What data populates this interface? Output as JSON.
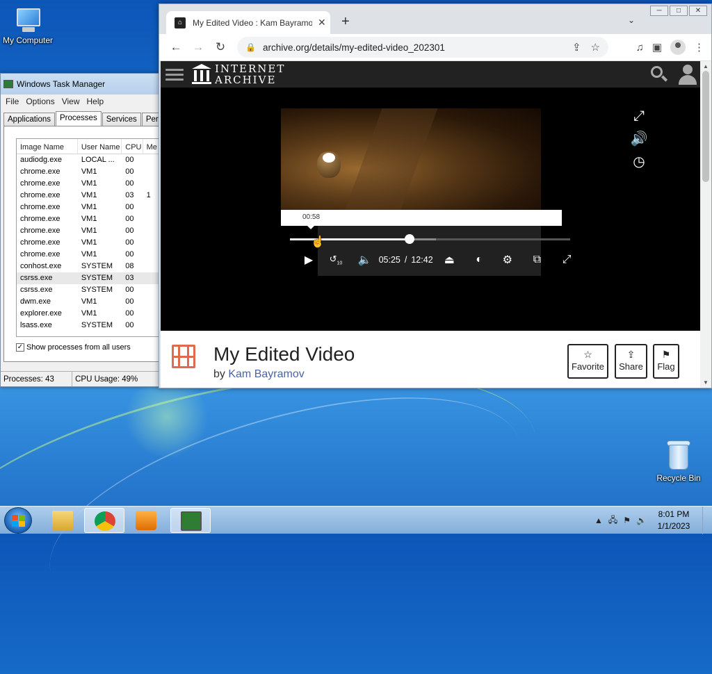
{
  "desktop": {
    "my_computer": "My Computer",
    "recycle_bin": "Recycle Bin"
  },
  "task_manager": {
    "title": "Windows Task Manager",
    "menu": [
      "File",
      "Options",
      "View",
      "Help"
    ],
    "tabs": [
      "Applications",
      "Processes",
      "Services",
      "Perform"
    ],
    "active_tab": "Processes",
    "columns": [
      "Image Name",
      "User Name",
      "CPU",
      "Me"
    ],
    "rows": [
      {
        "name": "audiodg.exe",
        "user": "LOCAL ...",
        "cpu": "00",
        "mem": ""
      },
      {
        "name": "chrome.exe",
        "user": "VM1",
        "cpu": "00",
        "mem": ""
      },
      {
        "name": "chrome.exe",
        "user": "VM1",
        "cpu": "00",
        "mem": ""
      },
      {
        "name": "chrome.exe",
        "user": "VM1",
        "cpu": "03",
        "mem": "1"
      },
      {
        "name": "chrome.exe",
        "user": "VM1",
        "cpu": "00",
        "mem": ""
      },
      {
        "name": "chrome.exe",
        "user": "VM1",
        "cpu": "00",
        "mem": ""
      },
      {
        "name": "chrome.exe",
        "user": "VM1",
        "cpu": "00",
        "mem": ""
      },
      {
        "name": "chrome.exe",
        "user": "VM1",
        "cpu": "00",
        "mem": ""
      },
      {
        "name": "chrome.exe",
        "user": "VM1",
        "cpu": "00",
        "mem": ""
      },
      {
        "name": "conhost.exe",
        "user": "SYSTEM",
        "cpu": "08",
        "mem": ""
      },
      {
        "name": "csrss.exe",
        "user": "SYSTEM",
        "cpu": "03",
        "mem": ""
      },
      {
        "name": "csrss.exe",
        "user": "SYSTEM",
        "cpu": "00",
        "mem": ""
      },
      {
        "name": "dwm.exe",
        "user": "VM1",
        "cpu": "00",
        "mem": ""
      },
      {
        "name": "explorer.exe",
        "user": "VM1",
        "cpu": "00",
        "mem": ""
      },
      {
        "name": "lsass.exe",
        "user": "SYSTEM",
        "cpu": "00",
        "mem": ""
      }
    ],
    "show_all_label": "Show processes from all users",
    "status_processes": "Processes: 43",
    "status_cpu": "CPU Usage: 49%"
  },
  "browser": {
    "tab_title": "My Edited Video : Kam Bayramov",
    "url": "archive.org/details/my-edited-video_202301",
    "window_controls": [
      "─",
      "□",
      "✕"
    ]
  },
  "archive": {
    "logo_line1": "INTERNET",
    "logo_line2": "ARCHIVE",
    "player": {
      "preview_time": "00:58",
      "current_time": "05:25",
      "separator": "/",
      "duration": "12:42",
      "progress_fraction": 0.426,
      "buffered_fraction": 0.52,
      "skip_seconds": "10"
    },
    "video_title": "My Edited Video",
    "by_label": "by",
    "author": "Kam Bayramov",
    "actions": [
      {
        "label": "Favorite",
        "icon": "star-icon"
      },
      {
        "label": "Share",
        "icon": "share-icon"
      },
      {
        "label": "Flag",
        "icon": "flag-icon"
      }
    ]
  },
  "taskbar": {
    "time": "8:01 PM",
    "date": "1/1/2023"
  }
}
